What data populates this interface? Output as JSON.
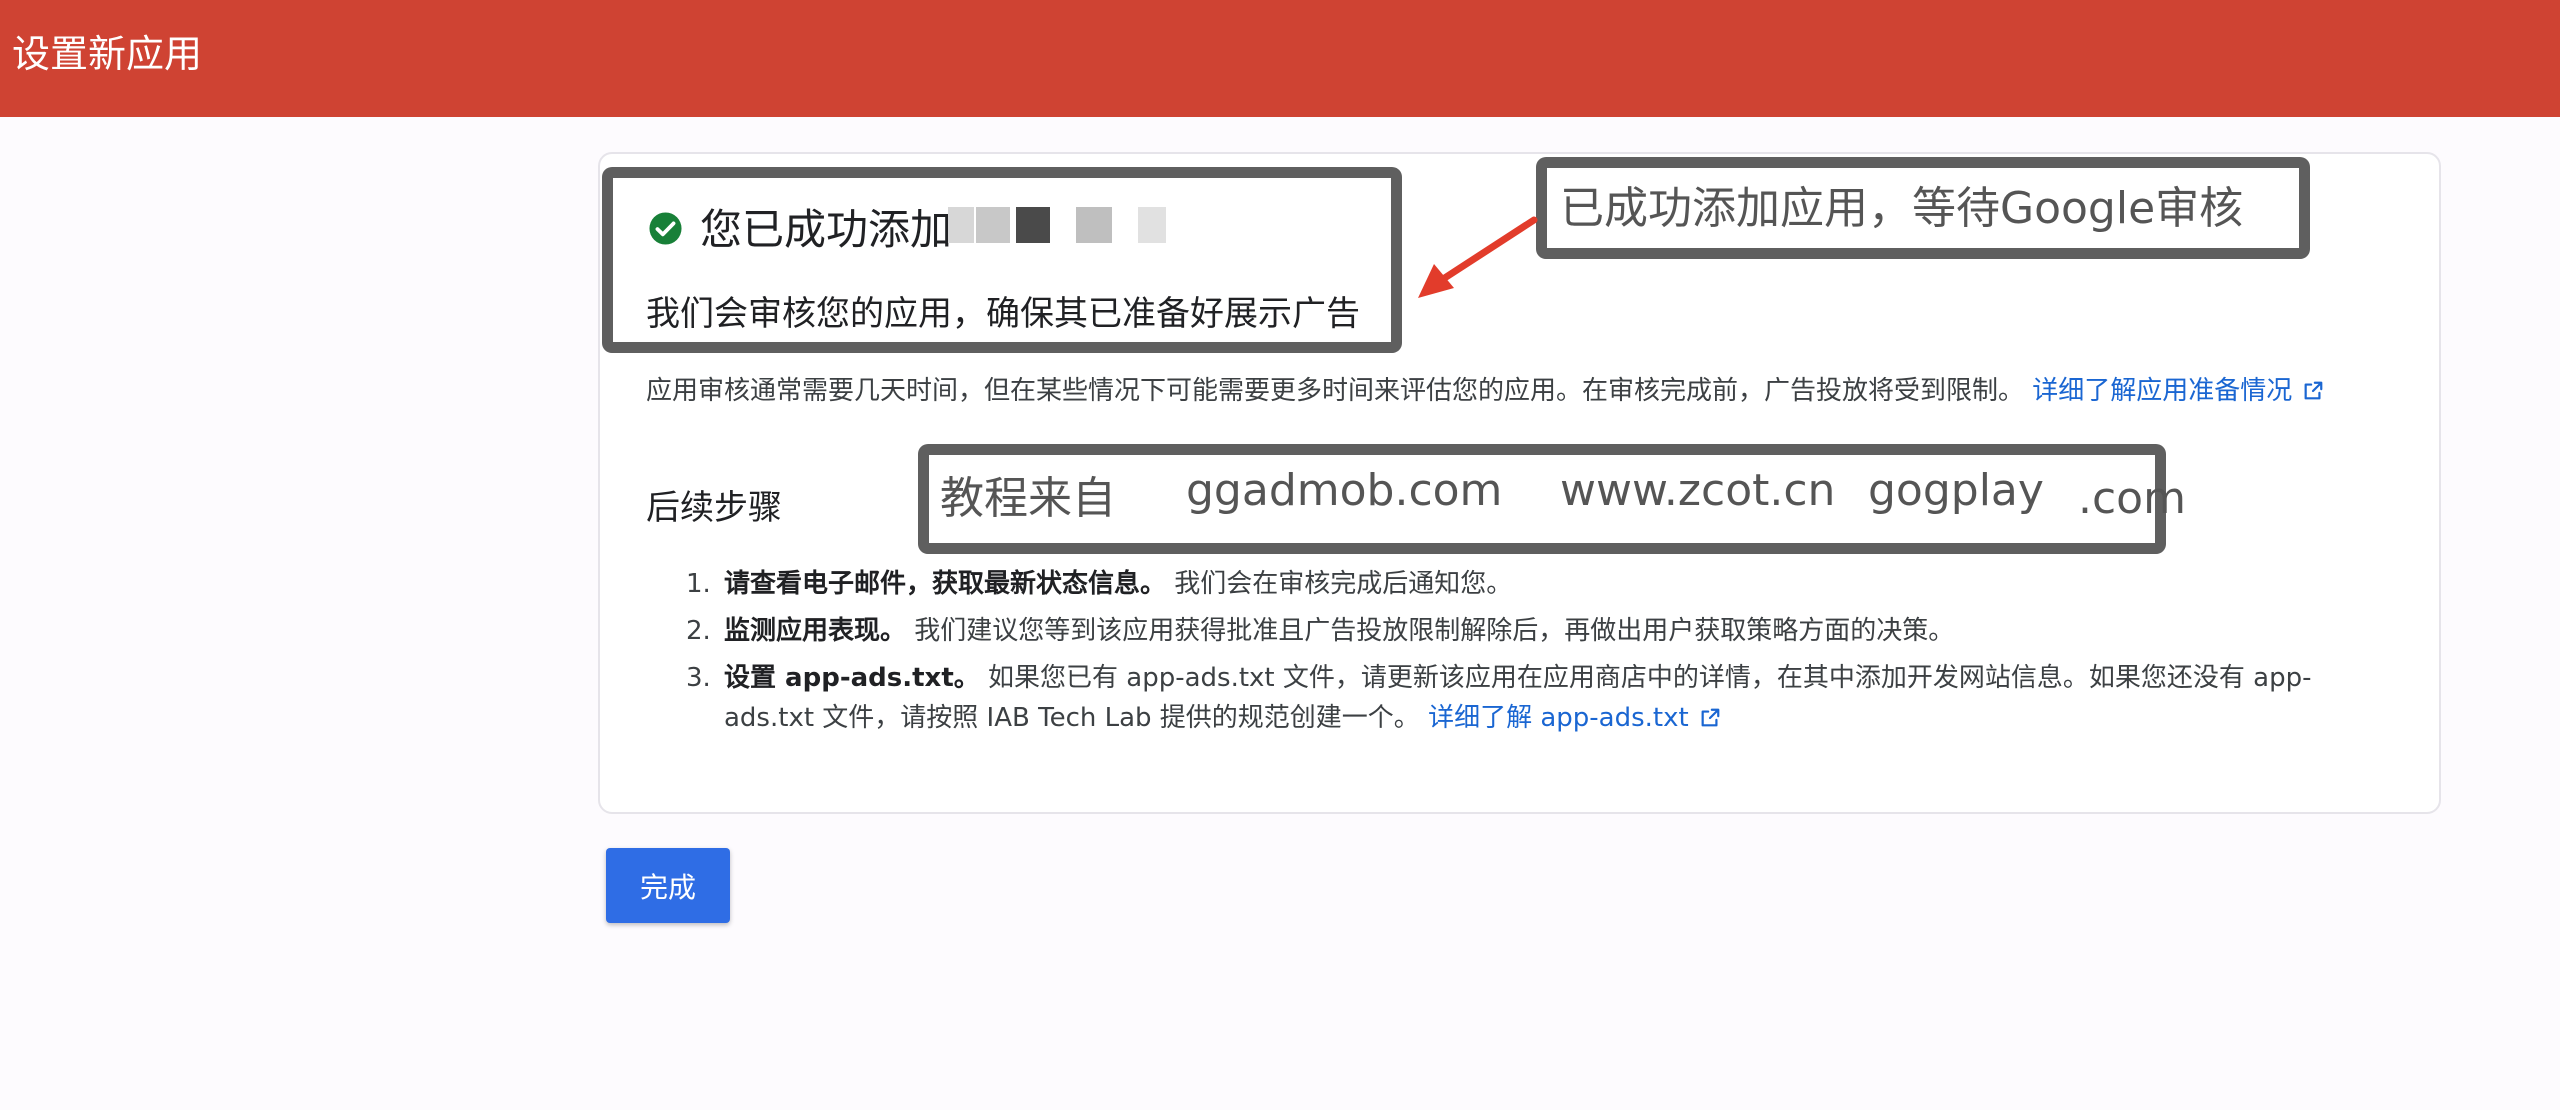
{
  "header": {
    "title": "设置新应用"
  },
  "success": {
    "title": "您已成功添加",
    "subtitle": "我们会审核您的应用，确保其已准备好展示广告",
    "icon": "check-circle-icon",
    "icon_color": "#188038"
  },
  "annotations": {
    "notice": "已成功添加应用，等待Google审核",
    "tutorial_prefix": "教程来自",
    "tutorial_sites": [
      "ggadmob.com",
      "www.zcot.cn",
      "gogplay",
      ".com"
    ]
  },
  "description": {
    "text": "应用审核通常需要几天时间，但在某些情况下可能需要更多时间来评估您的应用。在审核完成前，广告投放将受到限制。",
    "link": "详细了解应用准备情况"
  },
  "next_steps": {
    "title": "后续步骤",
    "items": [
      {
        "num": "1.",
        "head": "请查看电子邮件，获取最新状态信息。",
        "text": "我们会在审核完成后通知您。"
      },
      {
        "num": "2.",
        "head": "监测应用表现。",
        "text": "我们建议您等到该应用获得批准且广告投放限制解除后，再做出用户获取策略方面的决策。"
      },
      {
        "num": "3.",
        "head": "设置 app-ads.txt。",
        "text": "如果您已有 app-ads.txt 文件，请更新该应用在应用商店中的详情，在其中添加开发网站信息。如果您还没有 app-ads.txt 文件，请按照 IAB Tech Lab 提供的规范创建一个。",
        "link": "详细了解 app-ads.txt"
      }
    ]
  },
  "actions": {
    "done_label": "完成"
  },
  "colors": {
    "header_bg": "#cf4333",
    "primary": "#2f6de5",
    "link": "#1a66d2",
    "annotation": "#5f5f5f"
  }
}
